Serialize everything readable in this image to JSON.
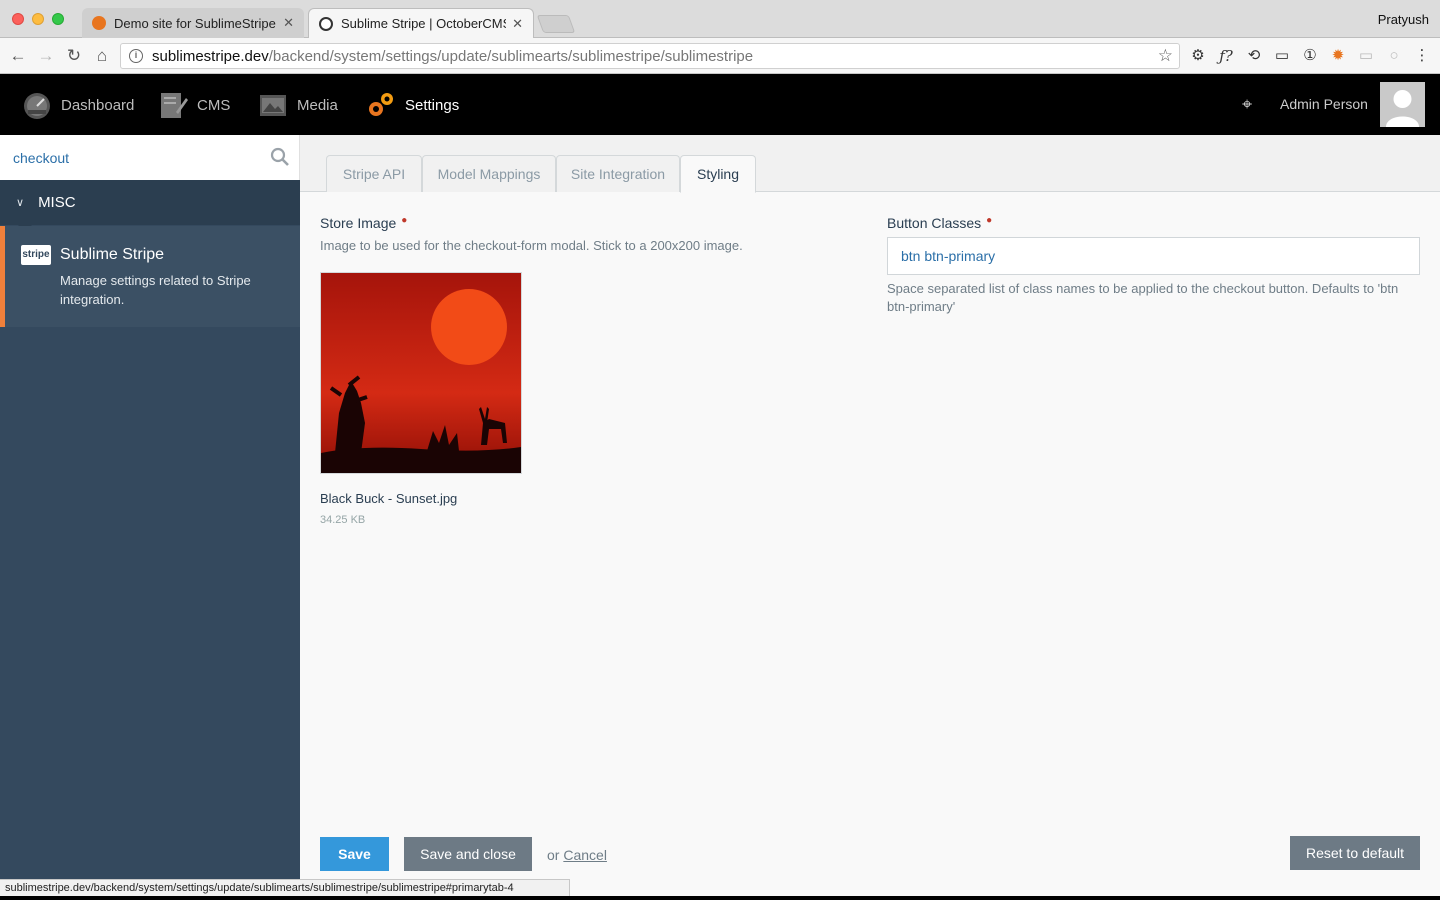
{
  "browser": {
    "tabs": [
      {
        "title": "Demo site for SublimeStripe P",
        "active": false
      },
      {
        "title": "Sublime Stripe | OctoberCMS",
        "active": true
      }
    ],
    "profile": "Pratyush",
    "url_host": "sublimestripe.dev",
    "url_path": "/backend/system/settings/update/sublimearts/sublimestripe/sublimestripe",
    "status_url": "sublimestripe.dev/backend/system/settings/update/sublimearts/sublimestripe/sublimestripe#primarytab-4",
    "extension_icons": [
      "gear-icon",
      "f-question-icon",
      "sync-icon",
      "cast-icon",
      "one-password-icon",
      "puzzle-icon",
      "message-icon",
      "circle-icon",
      "kebab-menu-icon"
    ]
  },
  "header": {
    "nav": [
      {
        "label": "Dashboard",
        "icon": "dashboard-icon"
      },
      {
        "label": "CMS",
        "icon": "cms-icon"
      },
      {
        "label": "Media",
        "icon": "media-icon"
      },
      {
        "label": "Settings",
        "icon": "settings-icon",
        "active": true
      }
    ],
    "user_name": "Admin Person"
  },
  "sidebar": {
    "search_value": "checkout",
    "group_label": "MISC",
    "item": {
      "logo": "stripe",
      "title": "Sublime Stripe",
      "description": "Manage settings related to Stripe integration."
    },
    "accent_color": "#f0803b"
  },
  "tabs": [
    "Stripe API",
    "Model Mappings",
    "Site Integration",
    "Styling"
  ],
  "active_tab": "Styling",
  "form": {
    "store_image": {
      "label": "Store Image",
      "comment": "Image to be used for the checkout-form modal. Stick to a 200x200 image.",
      "file_name": "Black Buck - Sunset.jpg",
      "file_size": "34.25 KB"
    },
    "button_classes": {
      "label": "Button Classes",
      "value": "btn btn-primary",
      "comment": "Space separated list of class names to be applied to the checkout button. Defaults to 'btn btn-primary'"
    }
  },
  "actions": {
    "save": "Save",
    "save_close": "Save and close",
    "or": "or",
    "cancel": "Cancel",
    "reset": "Reset to default"
  }
}
